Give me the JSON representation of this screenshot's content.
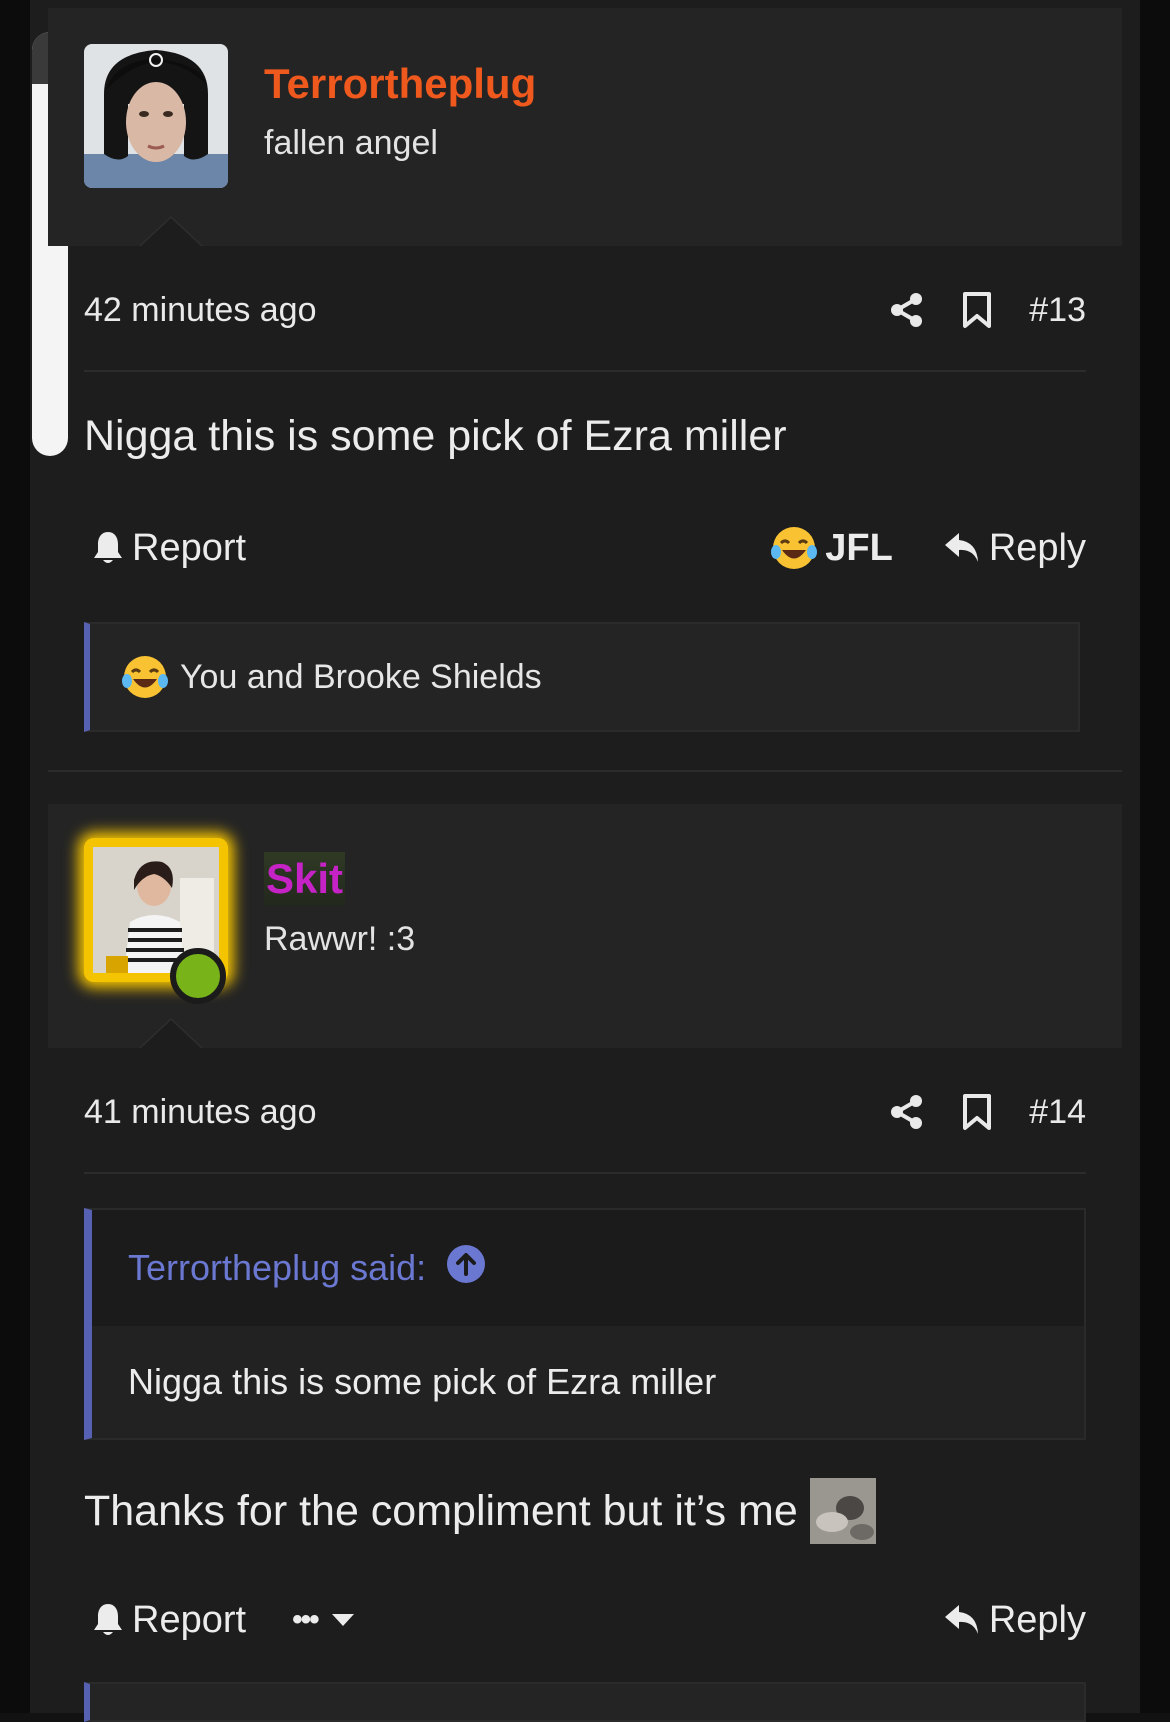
{
  "posts": [
    {
      "username": "Terrortheplug",
      "user_title": "fallen angel",
      "timestamp": "42 minutes ago",
      "post_number": "#13",
      "message": "Nigga this is some pick of Ezra miller",
      "actions": {
        "report_label": "Report",
        "reaction_label": "JFL",
        "reply_label": "Reply"
      },
      "reaction_summary": "You and Brooke Shields"
    },
    {
      "username": "Skit",
      "user_title": "Rawwr! :3",
      "timestamp": "41 minutes ago",
      "post_number": "#14",
      "quote": {
        "attribution": "Terrortheplug said:",
        "text": "Nigga this is some pick of Ezra miller"
      },
      "message": "Thanks for the compliment but it’s me",
      "actions": {
        "report_label": "Report",
        "more_label": "•••",
        "reply_label": "Reply"
      }
    }
  ],
  "colors": {
    "username_primary": "#f0591d",
    "username_secondary": "#c623c6",
    "accent_quote": "#5661b3",
    "online": "#78b31a"
  },
  "icons": [
    "share-icon",
    "bookmark-icon",
    "bell-icon",
    "reply-icon",
    "laughing-tears-emoji",
    "arrow-up-circle-icon",
    "chevron-down-icon"
  ]
}
